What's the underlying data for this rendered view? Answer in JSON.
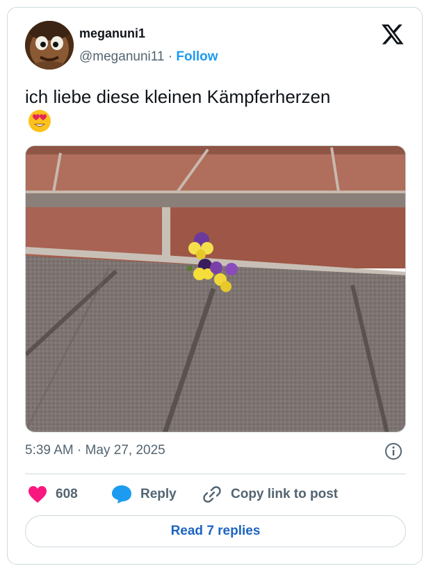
{
  "author": {
    "display_name": "meganuni1",
    "handle": "@meganuni11",
    "separator": "·",
    "follow_label": "Follow"
  },
  "tweet": {
    "text": "ich liebe diese kleinen Kämpferherzen",
    "emoji": "smiling-face-with-heart-eyes",
    "timestamp": "5:39 AM · May 27, 2025",
    "image_description_icon": "info-icon"
  },
  "actions": {
    "like_count": "608",
    "reply_label": "Reply",
    "copy_label": "Copy link to post"
  },
  "read_replies_label": "Read 7 replies",
  "colors": {
    "like": "#f91880",
    "reply": "#1d9bf0",
    "follow": "#1d9bf0",
    "read_replies": "#1d64c0"
  }
}
